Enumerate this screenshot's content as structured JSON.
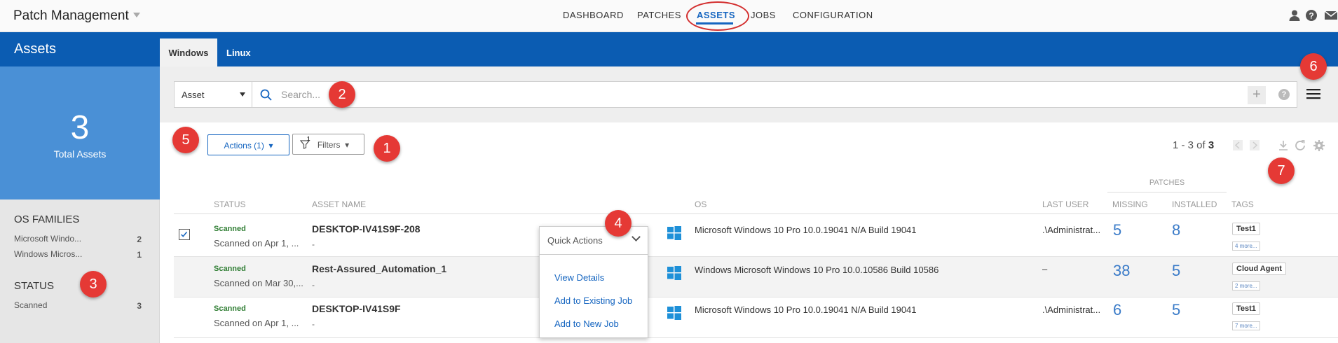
{
  "app": {
    "title": "Patch Management"
  },
  "nav": {
    "items": [
      {
        "label": "DASHBOARD"
      },
      {
        "label": "PATCHES"
      },
      {
        "label": "ASSETS"
      },
      {
        "label": "JOBS"
      },
      {
        "label": "CONFIGURATION"
      }
    ],
    "active": "ASSETS"
  },
  "sidebar": {
    "title": "Assets",
    "kpi_value": "3",
    "kpi_label": "Total Assets",
    "os_families_heading": "OS FAMILIES",
    "os_families": [
      {
        "label": "Microsoft Windo...",
        "count": "2"
      },
      {
        "label": "Windows Micros...",
        "count": "1"
      }
    ],
    "status_heading": "STATUS",
    "statuses": [
      {
        "label": "Scanned",
        "count": "3"
      }
    ]
  },
  "tabs": [
    {
      "label": "Windows"
    },
    {
      "label": "Linux"
    }
  ],
  "search": {
    "type_selected": "Asset",
    "placeholder": "Search...",
    "help": "?",
    "add": "+"
  },
  "toolbar": {
    "actions_label": "Actions (1)",
    "filters_label": "Filters",
    "filter_badge": "1",
    "paging_text": "1 - 3 of",
    "paging_total": "3"
  },
  "table": {
    "headers": {
      "status": "STATUS",
      "asset_name": "ASSET NAME",
      "os": "OS",
      "last_user": "LAST USER",
      "patches_group": "PATCHES",
      "missing": "MISSING",
      "installed": "INSTALLED",
      "tags": "TAGS"
    },
    "rows": [
      {
        "status": "Scanned",
        "scanned_on": "Scanned on Apr 1, ...",
        "name": "DESKTOP-IV41S9F-208",
        "sub": "-",
        "os": "Microsoft Windows 10 Pro 10.0.19041 N/A Build 19041",
        "last_user": ".\\Administrat...",
        "missing": "5",
        "installed": "8",
        "tag": "Test1",
        "more": "4 more...",
        "checked": true
      },
      {
        "status": "Scanned",
        "scanned_on": "Scanned on Mar 30,...",
        "name": "Rest-Assured_Automation_1",
        "sub": "-",
        "os": "Windows Microsoft Windows 10 Pro 10.0.10586 Build 10586",
        "last_user": "–",
        "missing": "38",
        "installed": "5",
        "tag": "Cloud Agent",
        "more": "2 more...",
        "checked": false
      },
      {
        "status": "Scanned",
        "scanned_on": "Scanned on Apr 1, ...",
        "name": "DESKTOP-IV41S9F",
        "sub": "-",
        "os": "Microsoft Windows 10 Pro 10.0.19041 N/A Build 19041",
        "last_user": ".\\Administrat...",
        "missing": "6",
        "installed": "5",
        "tag": "Test1",
        "more": "7 more...",
        "checked": false
      }
    ]
  },
  "quick_actions": {
    "title": "Quick Actions",
    "items": [
      "View Details",
      "Add to Existing Job",
      "Add to New Job"
    ]
  },
  "callouts": [
    "1",
    "2",
    "3",
    "4",
    "5",
    "6",
    "7"
  ],
  "colors": {
    "brand_blue": "#0b5cb2",
    "kpi_blue": "#4a90d6",
    "callout_red": "#e53935",
    "scanned_green": "#2e7d32",
    "link_blue": "#1565c0"
  }
}
